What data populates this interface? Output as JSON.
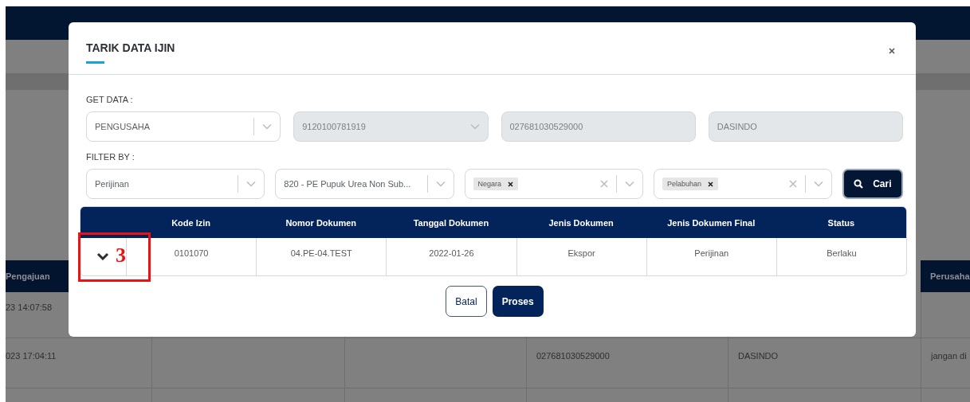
{
  "background_table": {
    "columns": [
      "Pengajuan",
      "",
      "",
      "",
      "",
      "Perusaha"
    ],
    "rows": [
      {
        "column_1": "23 14:07:58"
      },
      {
        "column_1": "023 17:04:11",
        "column_4": "027681030529000",
        "column_5": "DASINDO",
        "column_6": "jangan di"
      }
    ]
  },
  "modal": {
    "title": "TARIK DATA IJIN",
    "get_data": {
      "label": "GET DATA :",
      "fields": [
        {
          "kind": "select",
          "value": "PENGUSAHA",
          "disabled": false
        },
        {
          "kind": "select",
          "value": "9120100781919",
          "disabled": true
        },
        {
          "kind": "input",
          "value": "027681030529000",
          "disabled": true
        },
        {
          "kind": "input",
          "value": "DASINDO",
          "disabled": true
        }
      ]
    },
    "filter": {
      "label": "FILTER BY :",
      "fields": [
        {
          "kind": "select",
          "value": "Perijinan",
          "disabled": false
        },
        {
          "kind": "select",
          "value": "820 - PE Pupuk Urea Non Sub...",
          "disabled": false
        },
        {
          "kind": "multiselect",
          "tags": [
            "Negara"
          ],
          "disabled": false
        },
        {
          "kind": "multiselect",
          "tags": [
            "Pelabuhan"
          ],
          "disabled": false
        }
      ],
      "search_button": "Cari"
    },
    "table": {
      "columns": [
        "",
        "Kode Izin",
        "Nomor Dokumen",
        "Tanggal Dokumen",
        "Jenis Dokumen",
        "Jenis Dokumen Final",
        "Status"
      ],
      "rows": [
        {
          "cells": [
            "",
            "0101070",
            "04.PE-04.TEST",
            "2022-01-26",
            "Ekspor",
            "Perijinan",
            "Berlaku"
          ]
        }
      ]
    },
    "buttons": [
      {
        "label": "Batal",
        "kind": "outline"
      },
      {
        "label": "Proses",
        "kind": "primary"
      }
    ]
  },
  "annotation": {
    "label": "3"
  }
}
